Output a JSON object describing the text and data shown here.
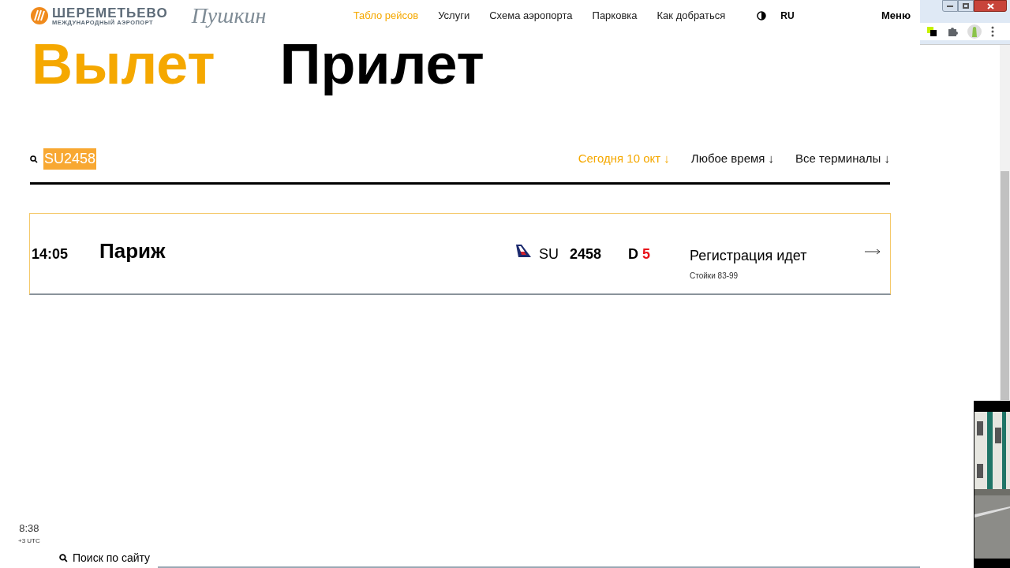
{
  "header": {
    "logo_title": "ШЕРЕМЕТЬЕВО",
    "logo_subtitle": "МЕЖДУНАРОДНЫЙ АЭРОПОРТ",
    "partner_logo": "Пушкин",
    "nav": [
      {
        "label": "Табло рейсов",
        "selected": true
      },
      {
        "label": "Услуги",
        "selected": false
      },
      {
        "label": "Схема аэропорта",
        "selected": false
      },
      {
        "label": "Парковка",
        "selected": false
      },
      {
        "label": "Как добраться",
        "selected": false
      }
    ],
    "language": "RU",
    "menu": "Меню"
  },
  "direction_tabs": [
    {
      "label": "Вылет",
      "selected": true
    },
    {
      "label": "Прилет",
      "selected": false
    }
  ],
  "search": {
    "value": "SU2458"
  },
  "filters": [
    {
      "label": "Сегодня 10 окт ↓",
      "selected": true
    },
    {
      "label": "Любое время ↓",
      "selected": false
    },
    {
      "label": "Все терминалы ↓",
      "selected": false
    }
  ],
  "flights": [
    {
      "time": "14:05",
      "city": "Париж",
      "airline": "SU",
      "number": "2458",
      "terminal": "D",
      "gate": "5",
      "status": "Регистрация идет",
      "counters": "Стойки 83-99"
    }
  ],
  "clock": {
    "time": "8:38",
    "zone": "+3 UTC"
  },
  "site_search": "Поиск по сайту"
}
